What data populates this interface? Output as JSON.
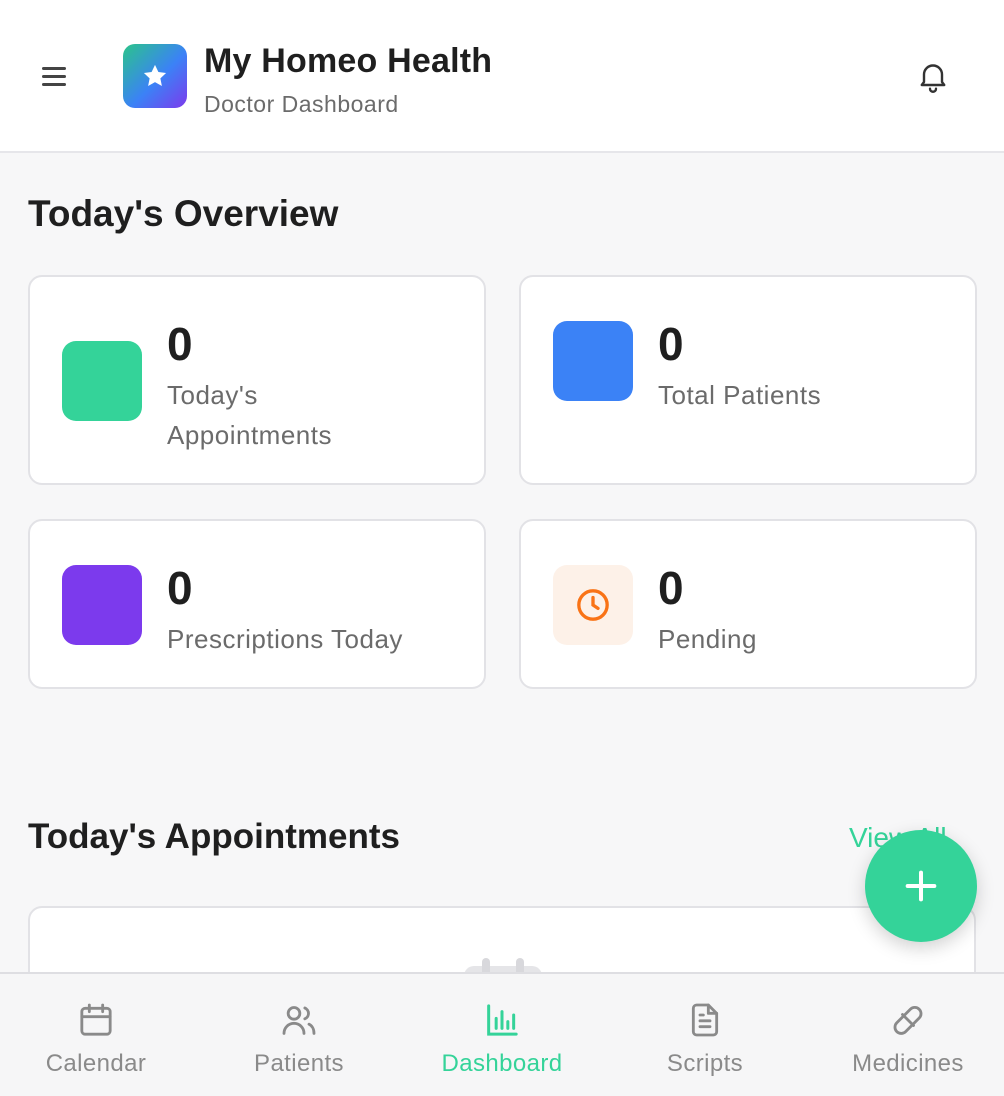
{
  "header": {
    "title": "My Homeo Health",
    "subtitle": "Doctor Dashboard",
    "menu_icon": "hamburger-menu-icon",
    "logo_icon": "star-icon",
    "notification_icon": "bell-icon"
  },
  "overview": {
    "title": "Today's Overview",
    "cards": [
      {
        "value": "0",
        "label_line1": "Today's",
        "label_line2": "Appointments",
        "color": "#34d399"
      },
      {
        "value": "0",
        "label_line1": "Total Patients",
        "color": "#3b82f6"
      },
      {
        "value": "0",
        "label_line1": "Prescriptions Today",
        "color": "#7c3aed"
      },
      {
        "value": "0",
        "label_line1": "Pending",
        "color": "#fdf1e8",
        "icon": "clock-icon",
        "icon_color": "#f97316"
      }
    ]
  },
  "appointments": {
    "title": "Today's Appointments",
    "view_all": "View All"
  },
  "fab": {
    "icon": "plus-icon"
  },
  "bottom_nav": {
    "items": [
      {
        "label": "Calendar",
        "icon": "calendar-icon"
      },
      {
        "label": "Patients",
        "icon": "users-icon"
      },
      {
        "label": "Dashboard",
        "icon": "bar-chart-icon",
        "active": true
      },
      {
        "label": "Scripts",
        "icon": "document-icon"
      },
      {
        "label": "Medicines",
        "icon": "pill-icon"
      }
    ]
  },
  "colors": {
    "accent": "#34d399",
    "text_primary": "#1f1f1f",
    "text_secondary": "#6b6b6b"
  }
}
